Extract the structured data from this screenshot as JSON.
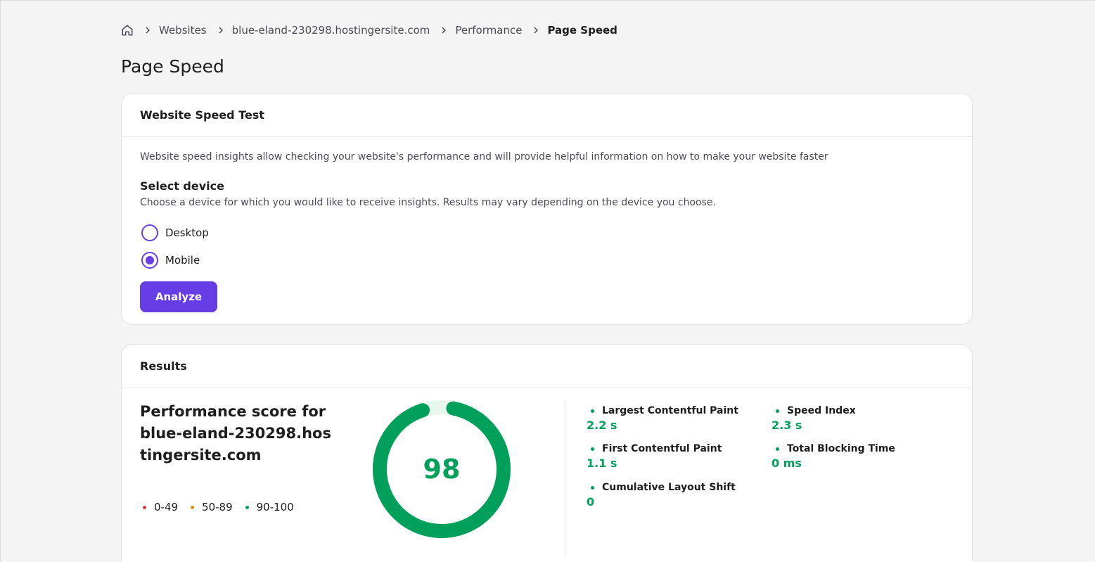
{
  "breadcrumb": {
    "home_icon": "home-icon",
    "items": [
      "Websites",
      "blue-eland-230298.hostingersite.com",
      "Performance"
    ],
    "current": "Page Speed"
  },
  "page_title": "Page Speed",
  "speed_test": {
    "title": "Website Speed Test",
    "description": "Website speed insights allow checking your website's performance and will provide helpful information on how to make your website faster",
    "select_device_title": "Select device",
    "select_device_desc": "Choose a device for which you would like to receive insights. Results may vary depending on the device you choose.",
    "options": [
      {
        "label": "Desktop",
        "selected": false
      },
      {
        "label": "Mobile",
        "selected": true
      }
    ],
    "analyze_label": "Analyze"
  },
  "results": {
    "title": "Results",
    "score_title": "Performance score for blue-eland-230298.hostingersite.com",
    "score": "98",
    "score_fraction": 0.98,
    "legend": [
      {
        "label": "0-49",
        "color": "#e2343f"
      },
      {
        "label": "50-89",
        "color": "#e88c00"
      },
      {
        "label": "90-100",
        "color": "#00a05a"
      }
    ],
    "metrics": [
      {
        "name": "Largest Contentful Paint",
        "value": "2.2 s"
      },
      {
        "name": "First Contentful Paint",
        "value": "1.1 s"
      },
      {
        "name": "Cumulative Layout Shift",
        "value": "0"
      },
      {
        "name": "Speed Index",
        "value": "2.3 s"
      },
      {
        "name": "Total Blocking Time",
        "value": "0 ms"
      }
    ]
  },
  "colors": {
    "accent": "#673de6",
    "good": "#00a05a",
    "text": "#1d1e20",
    "muted": "#4a4b57"
  }
}
